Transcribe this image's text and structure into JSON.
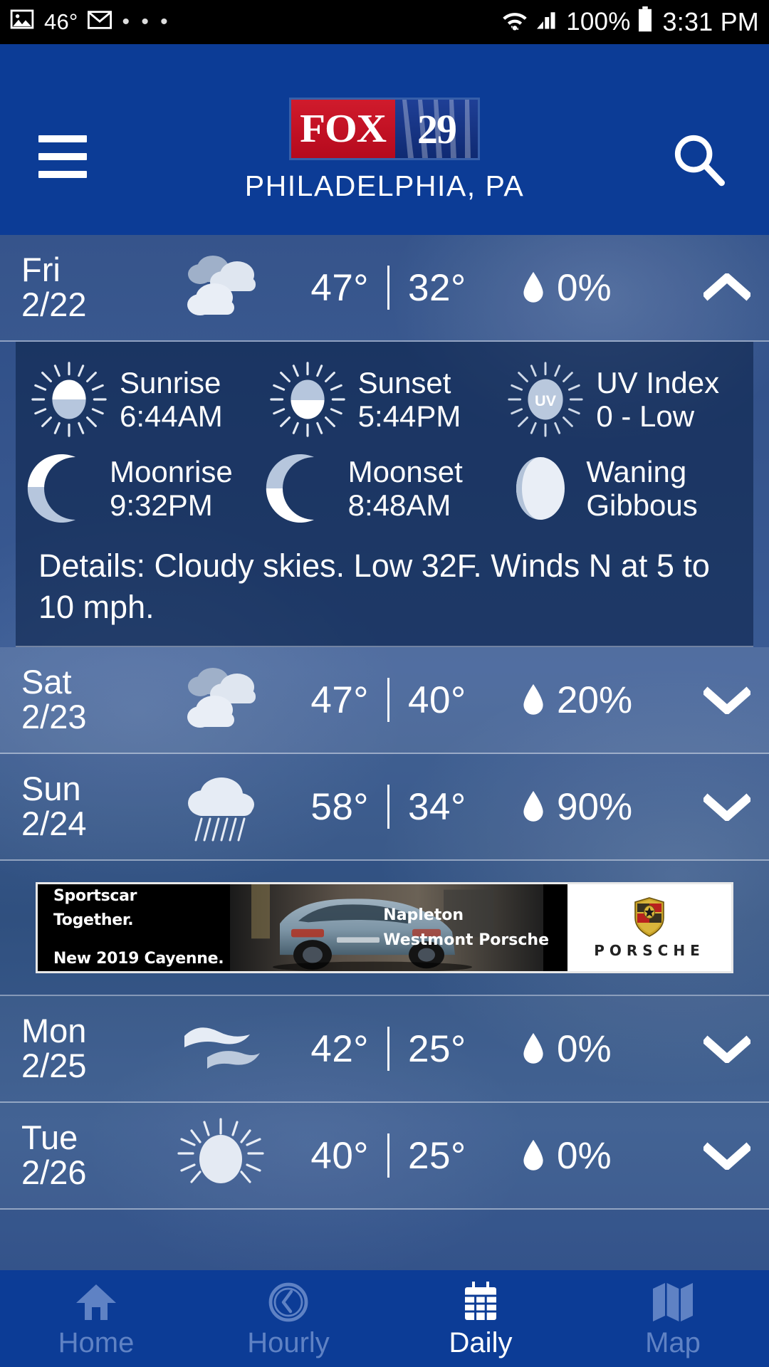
{
  "status_bar": {
    "image_temp": "46°",
    "icons": [
      "image-icon",
      "gmail-icon",
      "overflow-dots",
      "wifi-icon",
      "signal-icon",
      "battery-icon"
    ],
    "battery_pct": "100%",
    "time": "3:31 PM",
    "dots": "• • •"
  },
  "header": {
    "menu_icon": "hamburger-icon",
    "search_icon": "search-icon",
    "logo_fox": "FOX",
    "logo_channel": "29",
    "city": "PHILADELPHIA, PA",
    "bg_color": "#0c3c96",
    "logo_red": "#c8152a",
    "logo_blue": "#15358a"
  },
  "forecast": [
    {
      "dow": "Fri",
      "date": "2/22",
      "icon": "cloudy-icon",
      "high": "47°",
      "low": "32°",
      "precip": "0%",
      "expanded": true,
      "chevron": "chevron-up-icon",
      "detail": {
        "sunrise_label": "Sunrise",
        "sunrise_value": "6:44AM",
        "sunset_label": "Sunset",
        "sunset_value": "5:44PM",
        "uv_label": "UV Index",
        "uv_value": "0 - Low",
        "uv_badge": "UV",
        "moonrise_label": "Moonrise",
        "moonrise_value": "9:32PM",
        "moonset_label": "Moonset",
        "moonset_value": "8:48AM",
        "phase_label": "Waning",
        "phase_value": "Gibbous",
        "details": "Details: Cloudy skies. Low 32F. Winds N at 5 to 10 mph."
      }
    },
    {
      "dow": "Sat",
      "date": "2/23",
      "icon": "cloudy-icon",
      "high": "47°",
      "low": "40°",
      "precip": "20%",
      "expanded": false,
      "chevron": "chevron-down-icon"
    },
    {
      "dow": "Sun",
      "date": "2/24",
      "icon": "rain-icon",
      "high": "58°",
      "low": "34°",
      "precip": "90%",
      "expanded": false,
      "chevron": "chevron-down-icon"
    },
    {
      "dow": "Mon",
      "date": "2/25",
      "icon": "windy-icon",
      "high": "42°",
      "low": "25°",
      "precip": "0%",
      "expanded": false,
      "chevron": "chevron-down-icon"
    },
    {
      "dow": "Tue",
      "date": "2/26",
      "icon": "sunny-icon",
      "high": "40°",
      "low": "25°",
      "precip": "0%",
      "expanded": false,
      "chevron": "chevron-down-icon"
    }
  ],
  "ad": {
    "line1": "Sportscar",
    "line2": "Together.",
    "line3": "New 2019 Cayenne.",
    "dealer1": "Napleton",
    "dealer2": "Westmont Porsche",
    "brand_word": "PORSCHE",
    "crest_icon": "porsche-crest-icon"
  },
  "bottom_nav": [
    {
      "label": "Home",
      "icon": "home-icon",
      "active": false
    },
    {
      "label": "Hourly",
      "icon": "clock-icon",
      "active": false
    },
    {
      "label": "Daily",
      "icon": "calendar-icon",
      "active": true
    },
    {
      "label": "Map",
      "icon": "map-icon",
      "active": false
    }
  ],
  "colors": {
    "brand_blue": "#0c3c96",
    "nav_inactive": "#5f82c4",
    "nav_active": "#ffffff",
    "divider": "#d7dee8"
  }
}
